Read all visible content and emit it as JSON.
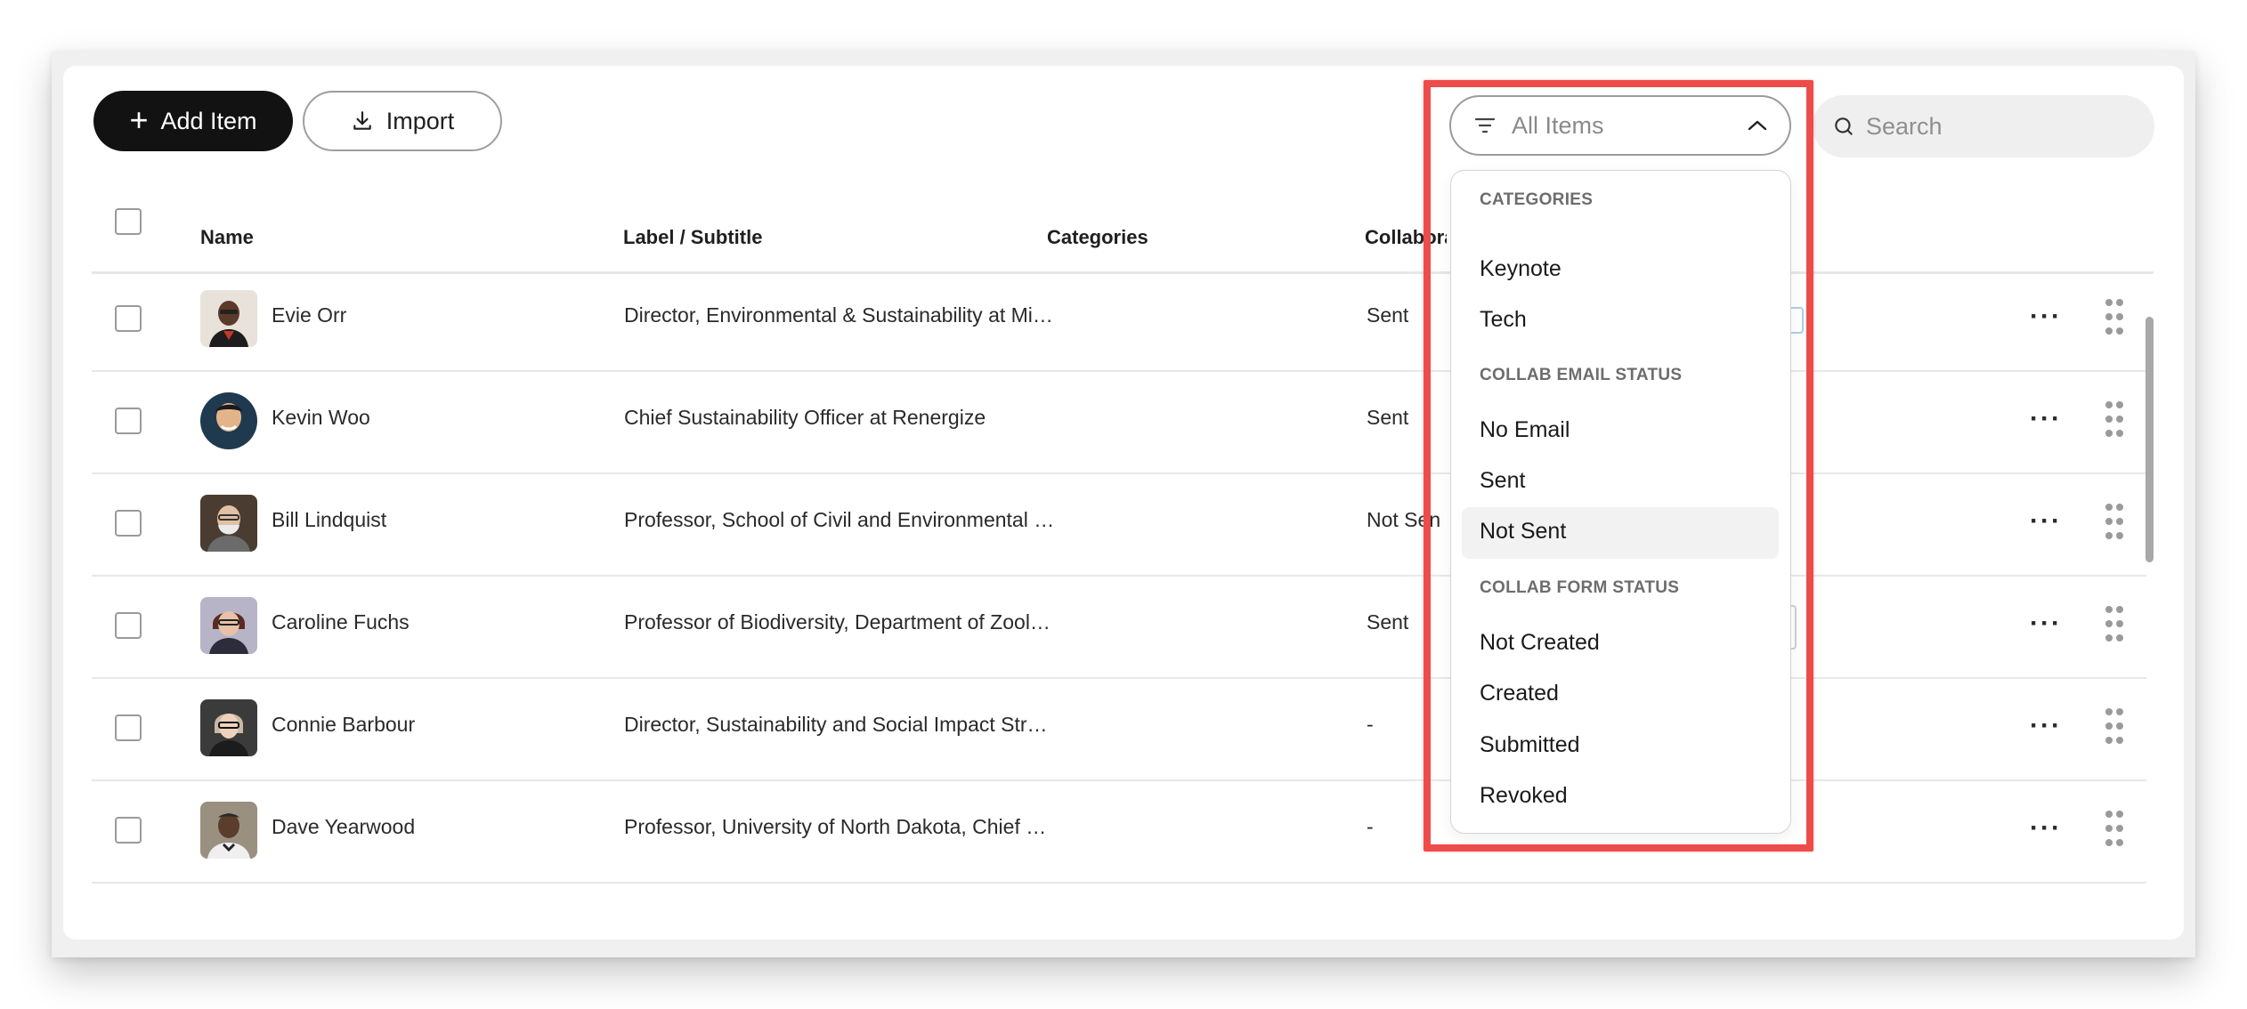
{
  "toolbar": {
    "add_label": "Add Item",
    "import_label": "Import",
    "filter_placeholder": "All Items",
    "search_placeholder": "Search"
  },
  "table": {
    "columns": [
      "Name",
      "Label / Subtitle",
      "Categories",
      "Collaborator"
    ],
    "rows": [
      {
        "name": "Evie Orr",
        "subtitle": "Director, Environmental & Sustainability at Mi…",
        "categories": "",
        "status": "Sent"
      },
      {
        "name": "Kevin Woo",
        "subtitle": "Chief Sustainability Officer at Renergize",
        "categories": "",
        "status": "Sent"
      },
      {
        "name": "Bill Lindquist",
        "subtitle": "Professor, School of Civil and Environmental …",
        "categories": "",
        "status": "Not Sent"
      },
      {
        "name": "Caroline Fuchs",
        "subtitle": "Professor of Biodiversity, Department of Zool…",
        "categories": "",
        "status": "Sent"
      },
      {
        "name": "Connie Barbour",
        "subtitle": "Director, Sustainability and Social Impact Str…",
        "categories": "",
        "status": "-"
      },
      {
        "name": "Dave Yearwood",
        "subtitle": "Professor, University of North Dakota, Chief …",
        "categories": "",
        "status": "-"
      }
    ],
    "row_action": "···"
  },
  "dropdown": {
    "sections": [
      {
        "title": "CATEGORIES",
        "options": [
          "Keynote",
          "Tech"
        ]
      },
      {
        "title": "COLLAB EMAIL STATUS",
        "options": [
          "No Email",
          "Sent",
          "Not Sent"
        ]
      },
      {
        "title": "COLLAB FORM STATUS",
        "options": [
          "Not Created",
          "Created",
          "Submitted",
          "Revoked"
        ]
      }
    ],
    "highlighted_option": "Not Sent"
  },
  "colors": {
    "primary_button": "#121212",
    "annotation_box": "#ee4b4b",
    "hover_bg": "#f2f2f2"
  },
  "icons": [
    "plus-icon",
    "download-icon",
    "filter-lines-icon",
    "chevron-up-icon",
    "search-icon",
    "more-horizontal-icon",
    "drag-handle-icon"
  ]
}
